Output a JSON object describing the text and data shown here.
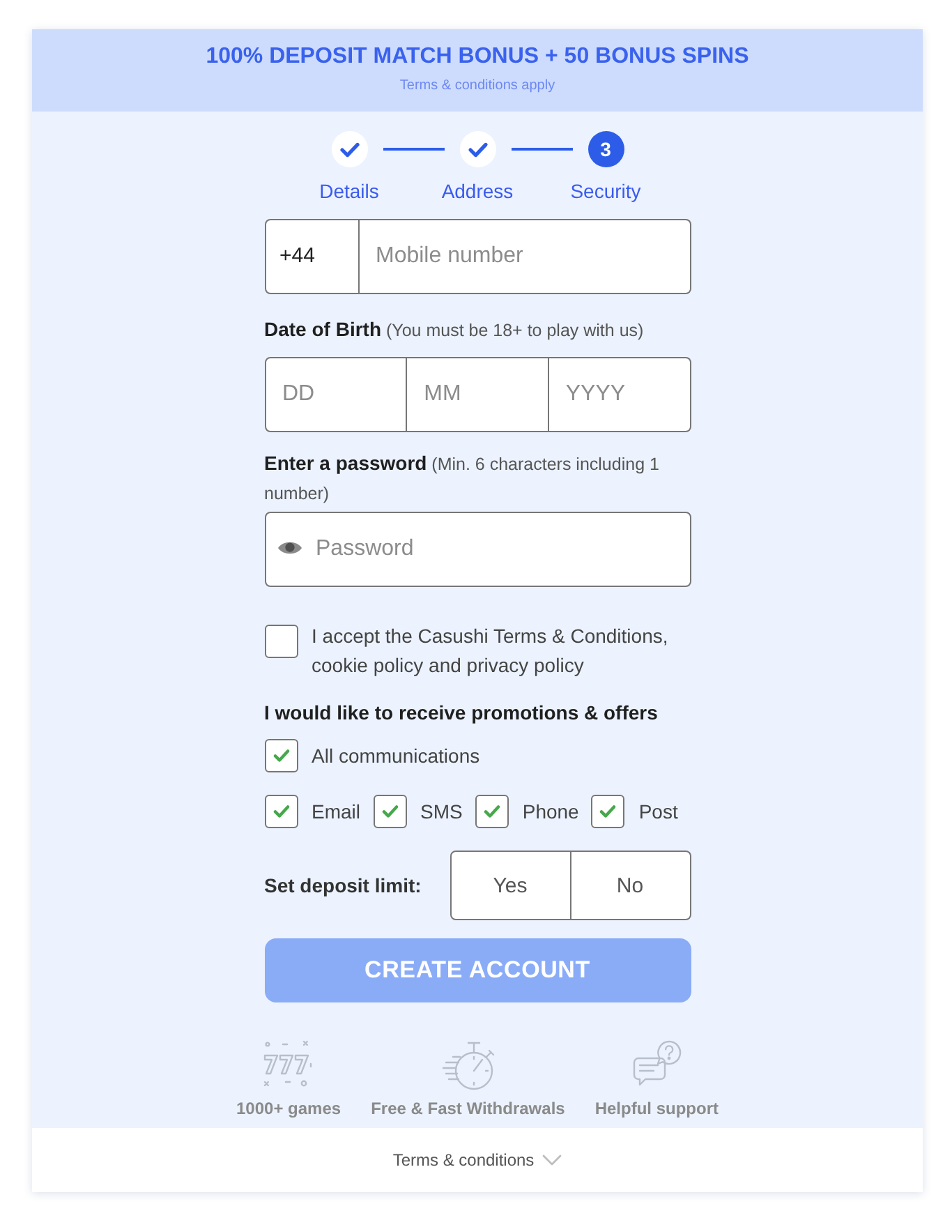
{
  "banner": {
    "title": "100% DEPOSIT MATCH BONUS + 50 BONUS SPINS",
    "subtitle": "Terms & conditions apply"
  },
  "steps": [
    {
      "label": "Details",
      "completed": true
    },
    {
      "label": "Address",
      "completed": true
    },
    {
      "label": "Security",
      "completed": false,
      "number": "3"
    }
  ],
  "phone": {
    "prefix": "+44",
    "placeholder": "Mobile number"
  },
  "date_of_birth": {
    "label": "**Date of Birth** (You must be 18+ to play with us)",
    "fields": [
      {
        "placeholder": "DD"
      },
      {
        "placeholder": "MM"
      },
      {
        "placeholder": "YYYY"
      }
    ]
  },
  "password": {
    "label": "**Enter a password** (Min. 6 characters including 1 number)",
    "placeholder": "Password"
  },
  "terms_checkbox": {
    "label": "I accept the Casushi Terms & Conditions, cookie policy and privacy policy",
    "checked": false
  },
  "promotions": {
    "heading": "I would like to receive promotions & offers",
    "all": {
      "label": "All communications",
      "checked": true
    },
    "channels": [
      {
        "label": "Email",
        "checked": true
      },
      {
        "label": "SMS",
        "checked": true
      },
      {
        "label": "Phone",
        "checked": true
      },
      {
        "label": "Post",
        "checked": true
      }
    ]
  },
  "deposit_limit": {
    "label": "Set deposit limit:",
    "options": [
      {
        "label": "Yes",
        "selected": false
      },
      {
        "label": "No",
        "selected": false
      }
    ]
  },
  "submit_button": {
    "label": "CREATE ACCOUNT",
    "disabled": true
  },
  "features": [
    {
      "kind": "games",
      "label": "1000+ games"
    },
    {
      "kind": "withdrawals",
      "label": "Free & Fast Withdrawals"
    },
    {
      "kind": "support",
      "label": "Helpful support"
    }
  ],
  "footer": {
    "link": "Terms & conditions",
    "expanded": false
  }
}
